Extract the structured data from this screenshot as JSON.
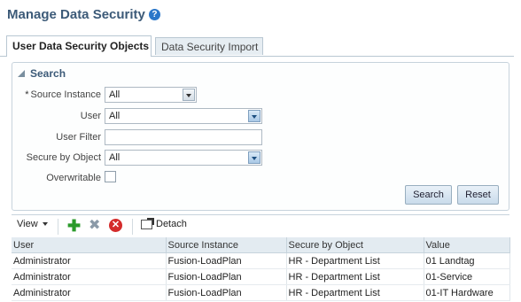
{
  "page": {
    "title": "Manage Data Security"
  },
  "tabs": [
    {
      "label": "User Data Security Objects",
      "active": true
    },
    {
      "label": "Data Security Import",
      "active": false
    }
  ],
  "search": {
    "title": "Search",
    "fields": {
      "source_instance": {
        "label": "Source Instance",
        "value": "All",
        "required": true
      },
      "user": {
        "label": "User",
        "value": "All"
      },
      "user_filter": {
        "label": "User Filter",
        "value": ""
      },
      "secure_by_object": {
        "label": "Secure by Object",
        "value": "All"
      },
      "overwritable": {
        "label": "Overwritable",
        "checked": false
      }
    },
    "search_button": "Search",
    "reset_button": "Reset"
  },
  "toolbar": {
    "view_label": "View",
    "detach_label": "Detach",
    "icons": [
      "add-icon",
      "delete-icon",
      "remove-icon",
      "detach-icon"
    ]
  },
  "table": {
    "columns": [
      "User",
      "Source Instance",
      "Secure by Object",
      "Value"
    ],
    "rows": [
      [
        "Administrator",
        "Fusion-LoadPlan",
        "HR - Department List",
        "01 Landtag"
      ],
      [
        "Administrator",
        "Fusion-LoadPlan",
        "HR - Department List",
        "01-Service"
      ],
      [
        "Administrator",
        "Fusion-LoadPlan",
        "HR - Department List",
        "01-IT Hardware"
      ]
    ]
  },
  "colors": {
    "title": "#3c5a78",
    "accent": "#2b77c9",
    "add": "#2b9a2b",
    "remove": "#d42b2b"
  }
}
